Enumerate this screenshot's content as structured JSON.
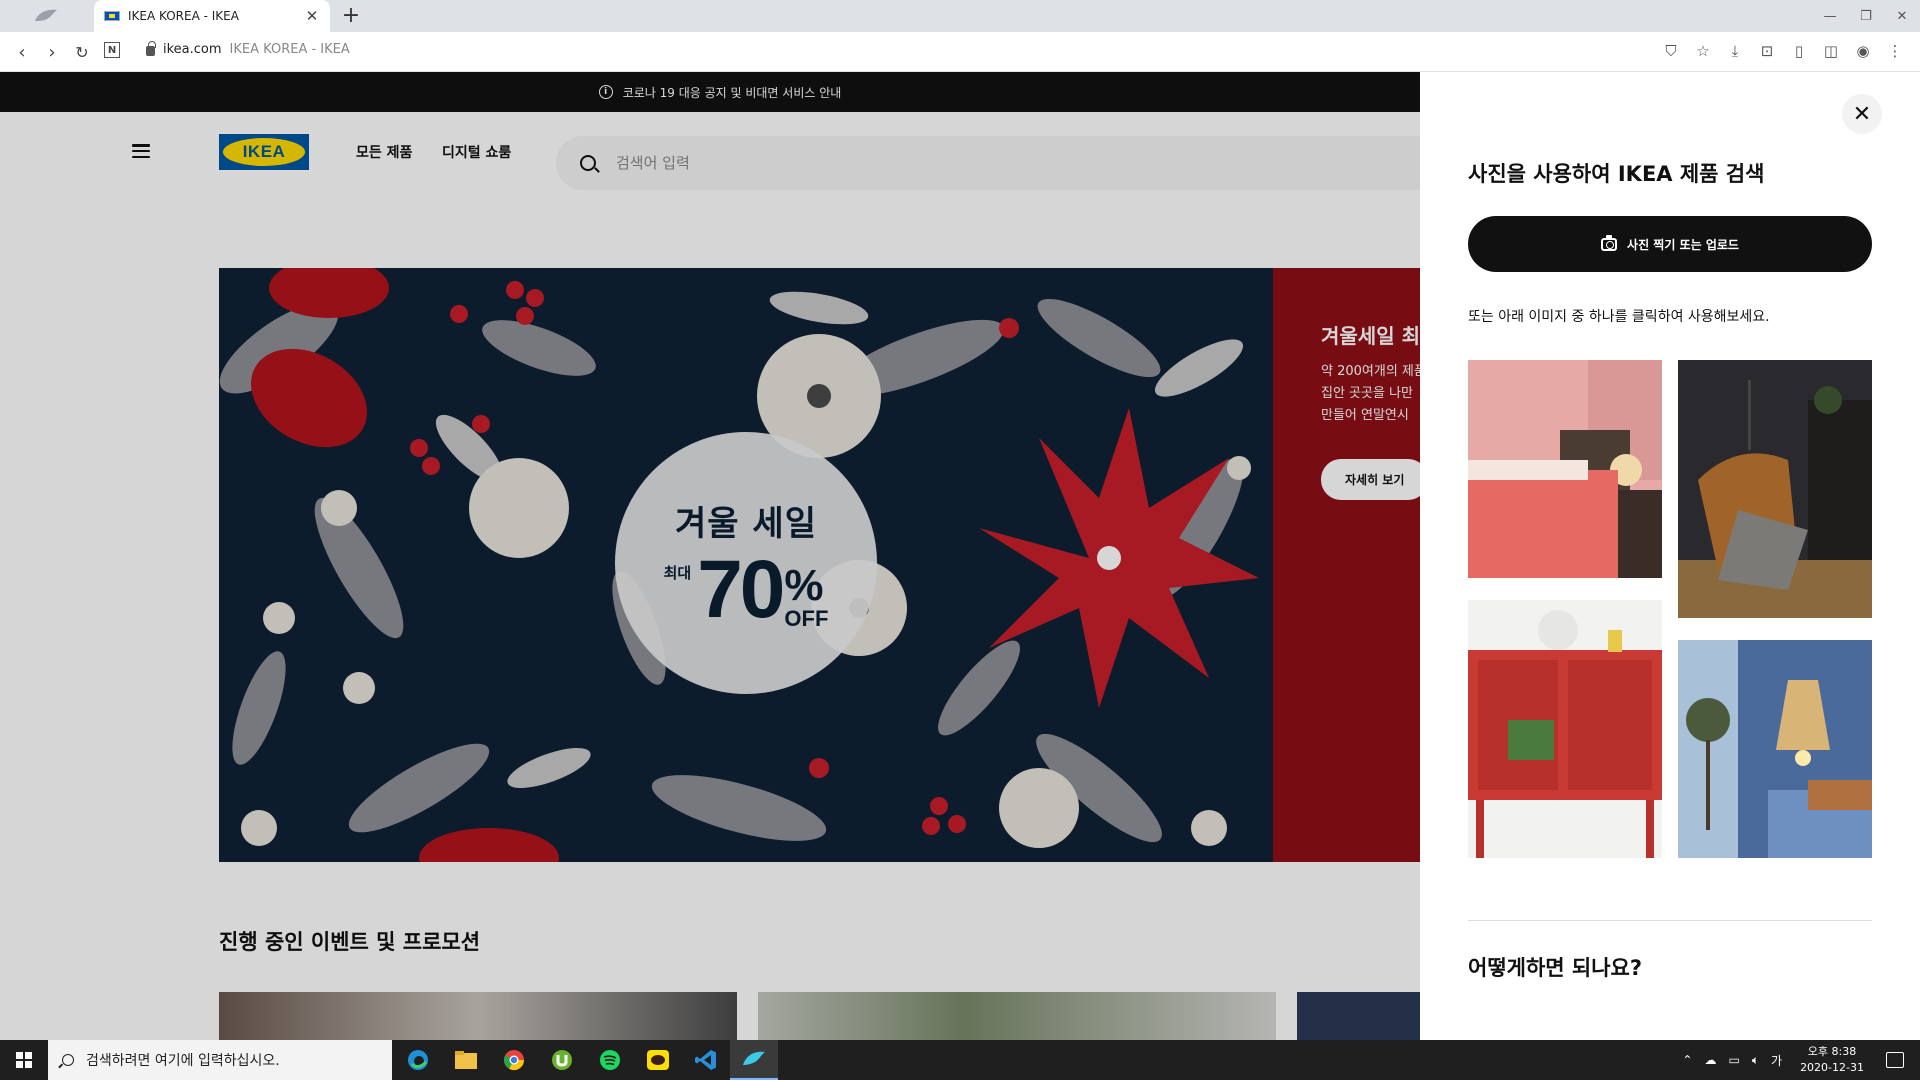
{
  "browser": {
    "tab_title": "IKEA KOREA - IKEA",
    "url_host": "ikea.com",
    "url_title": "IKEA KOREA - IKEA"
  },
  "notice": {
    "text": "코로나 19 대응 공지 및 비대면 서비스 안내"
  },
  "header": {
    "logo": "IKEA",
    "nav": [
      "모든 제품",
      "디지털 쇼룸"
    ],
    "search_placeholder": "검색어 입력"
  },
  "hero": {
    "circle_title": "겨울 세일",
    "circle_prefix": "최대",
    "circle_number": "70",
    "circle_percent": "%",
    "circle_off": "OFF",
    "panel_title": "겨울세일 최",
    "panel_body": "약 200여개의 제품\n집안 곳곳을 나만\n만들어 연말연시",
    "panel_button": "자세히 보기"
  },
  "section": {
    "title": "진행 중인 이벤트 및 프로모션"
  },
  "side_panel": {
    "title": "사진을 사용하여 IKEA 제품 검색",
    "upload_button": "사진 찍기 또는 업로드",
    "subtitle": "또는 아래 이미지 중 하나를 클릭하여 사용해보세요.",
    "how_title": "어떻게하면 되나요?"
  },
  "taskbar": {
    "search_placeholder": "검색하려면 여기에 입력하십시오.",
    "ime": "가",
    "time": "오후 8:38",
    "date": "2020-12-31"
  },
  "colors": {
    "ikea_blue": "#0058a3",
    "ikea_yellow": "#ffdb00",
    "hero_navy": "#0f2235",
    "hero_red": "#8e1016"
  }
}
